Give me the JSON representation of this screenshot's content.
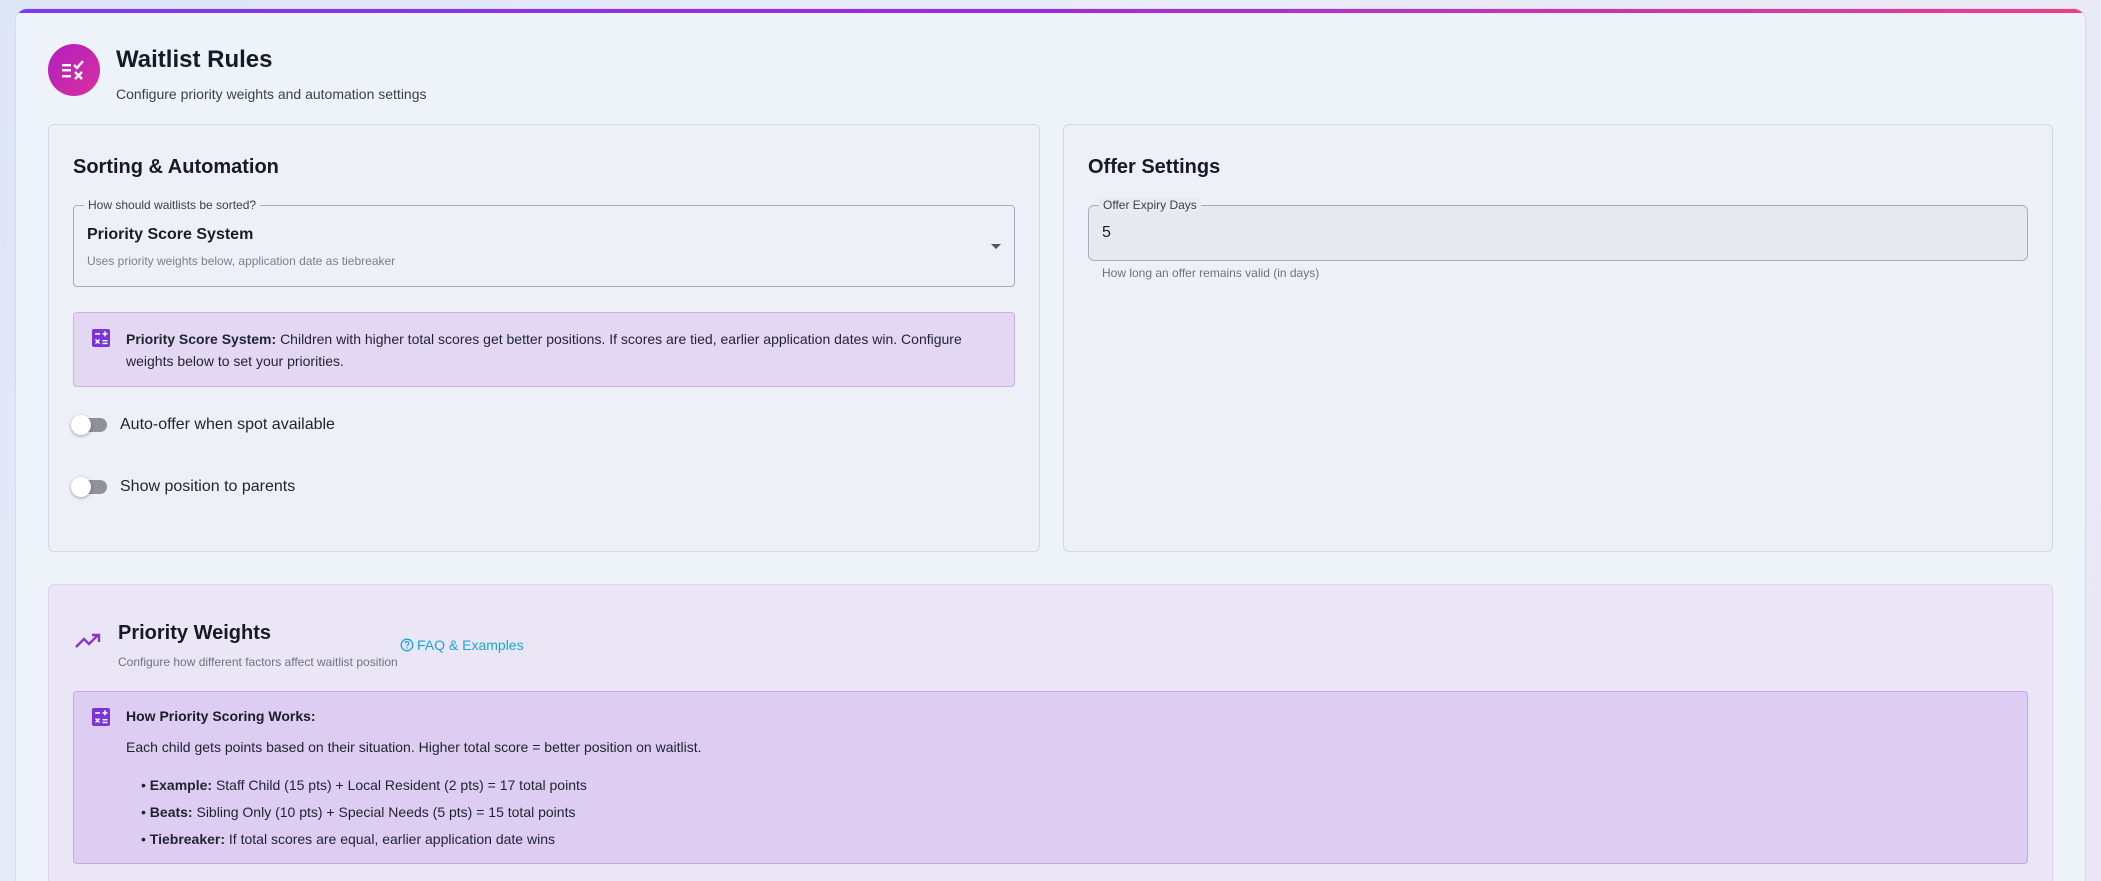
{
  "header": {
    "title": "Waitlist Rules",
    "subtitle": "Configure priority weights and automation settings",
    "icon": "rules-icon"
  },
  "sorting": {
    "title": "Sorting & Automation",
    "select_legend": "How should waitlists be sorted?",
    "select_value": "Priority Score System",
    "select_help": "Uses priority weights below, application date as tiebreaker",
    "info_label": "Priority Score System:",
    "info_text": "Children with higher total scores get better positions. If scores are tied, earlier application dates win. Configure weights below to set your priorities.",
    "toggles": [
      {
        "label": "Auto-offer when spot available",
        "checked": false
      },
      {
        "label": "Show position to parents",
        "checked": false
      }
    ]
  },
  "offer": {
    "title": "Offer Settings",
    "field_legend": "Offer Expiry Days",
    "field_value": "5",
    "field_help": "How long an offer remains valid (in days)"
  },
  "weights": {
    "title": "Priority Weights",
    "subtitle": "Configure how different factors affect waitlist position",
    "faq_label": "FAQ & Examples",
    "how_title": "How Priority Scoring Works:",
    "how_desc": "Each child gets points based on their situation. Higher total score = better position on waitlist.",
    "bullets": [
      {
        "label": "Example:",
        "text": "Staff Child (15 pts) + Local Resident (2 pts) = 17 total points"
      },
      {
        "label": "Beats:",
        "text": "Sibling Only (10 pts) + Special Needs (5 pts) = 15 total points"
      },
      {
        "label": "Tiebreaker:",
        "text": "If total scores are equal, earlier application date wins"
      }
    ]
  },
  "colors": {
    "accent_gradient_start": "#7c3aed",
    "accent_gradient_end": "#ec3f8a",
    "info_bg": "#e4d7f3",
    "link": "#1aa7d6"
  }
}
